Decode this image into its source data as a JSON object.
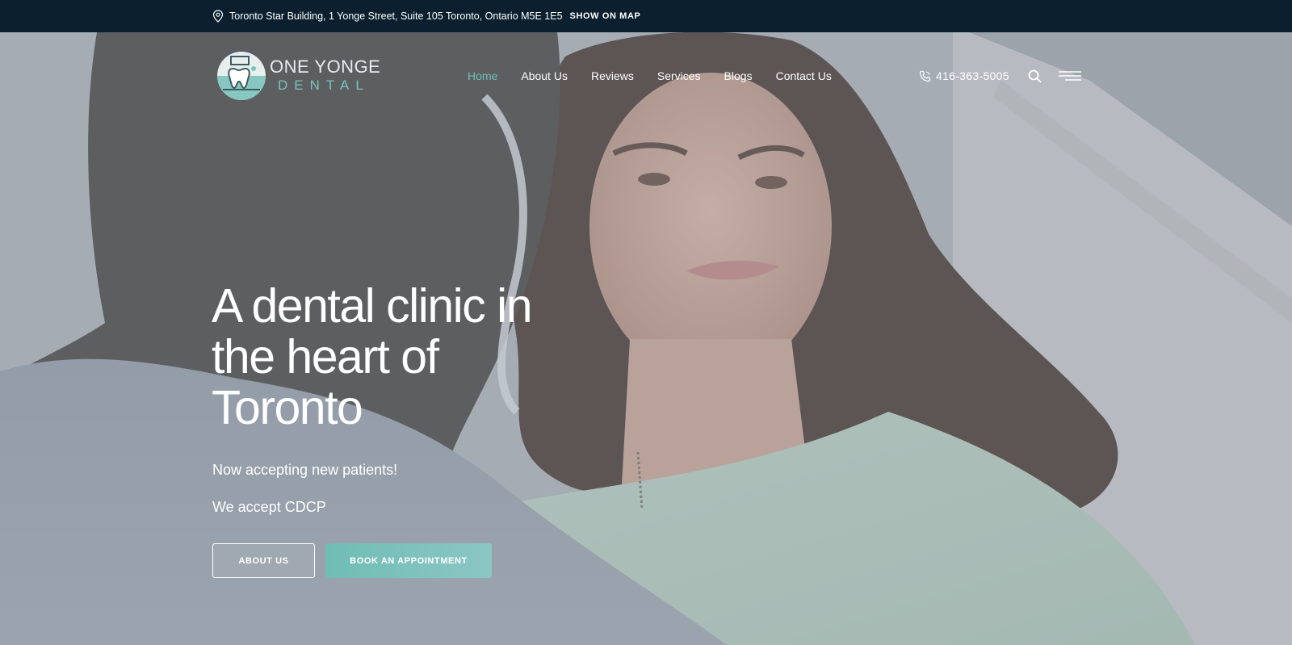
{
  "topbar": {
    "address": "Toronto Star Building, 1 Yonge Street, Suite 105 Toronto, Ontario M5E 1E5",
    "map_link": "SHOW ON MAP"
  },
  "logo": {
    "line1": "ONE YONGE",
    "line2": "DENTAL"
  },
  "nav": {
    "items": [
      {
        "label": "Home"
      },
      {
        "label": "About Us"
      },
      {
        "label": "Reviews"
      },
      {
        "label": "Services"
      },
      {
        "label": "Blogs"
      },
      {
        "label": "Contact Us"
      }
    ]
  },
  "header": {
    "phone": "416-363-5005"
  },
  "hero": {
    "title": "A dental clinic in the heart of Toronto",
    "line1": "Now accepting new patients!",
    "line2": "We accept CDCP",
    "btn_about": "ABOUT US",
    "btn_book": "BOOK AN APPOINTMENT"
  },
  "colors": {
    "topbar_bg": "#0b1f2e",
    "accent": "#6fc0b8",
    "text": "#ffffff"
  },
  "icons": [
    "location-pin-icon",
    "phone-icon",
    "search-icon",
    "hamburger-menu-icon",
    "tooth-logo-icon"
  ]
}
